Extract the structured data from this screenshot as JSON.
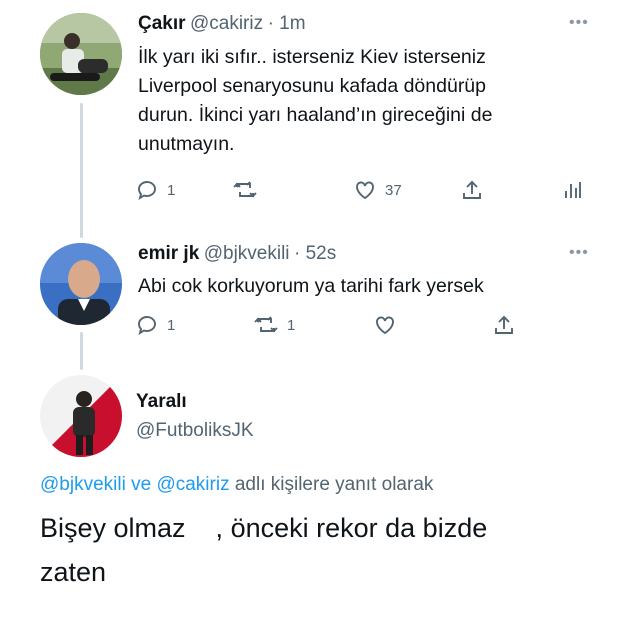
{
  "tweets": [
    {
      "name": "Çakır",
      "handle": "@cakiriz",
      "time": "· 1m",
      "text_lines": [
        "İlk yarı iki sıfır.. isterseniz Kiev isterseniz",
        "Liverpool senaryosunu kafada döndürüp",
        "durun. İkinci yarı haaland’ın gireceğini de",
        "unutmayın."
      ],
      "reply_count": "1",
      "retweet_count": "",
      "like_count": "37"
    },
    {
      "name": "emir jk",
      "handle": "@bjkvekili",
      "time": "· 52s",
      "text_lines": [
        "Abi cok korkuyorum ya tarihi fark yersek"
      ],
      "reply_count": "1",
      "retweet_count": "1",
      "like_count": ""
    }
  ],
  "main_tweet": {
    "name": "Yaralı",
    "handle": "@FutboliksJK",
    "reply_to": {
      "mention1": "@bjkvekili",
      "connector": "ve",
      "mention2": "@cakiriz",
      "suffix": "adlı kişilere yanıt olarak"
    },
    "text_line1_a": "Bişey olmaz",
    "text_line1_b": "önceki rekor da bizde",
    "text_line2": "zaten"
  },
  "icons": {
    "more": "more-dots-icon",
    "reply": "reply-icon",
    "retweet": "retweet-icon",
    "like": "heart-icon",
    "share": "share-icon",
    "analytics": "analytics-icon"
  },
  "colors": {
    "link": "#1d9bf0",
    "muted": "#536471",
    "text": "#0f1419"
  }
}
